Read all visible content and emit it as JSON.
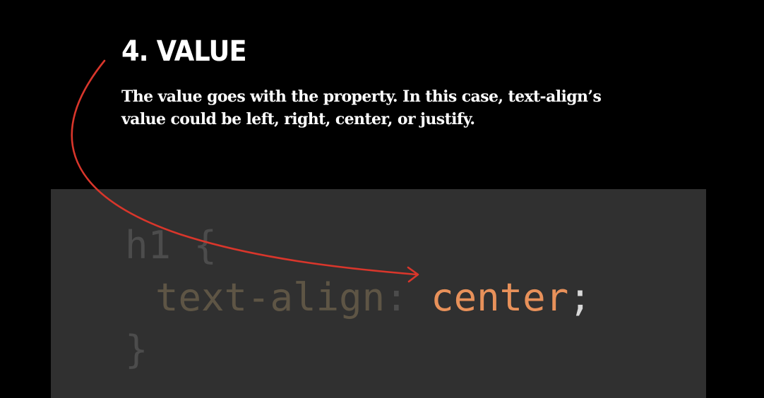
{
  "section": {
    "heading": "4. VALUE",
    "description": "The value goes with the property. In this case, text-align’s value could be left, right, center, or justify."
  },
  "code": {
    "selector": "h1",
    "brace_open": "{",
    "property": "text-align",
    "colon": ":",
    "value": "center",
    "semicolon": ";",
    "brace_close": "}"
  },
  "colors": {
    "background": "#000000",
    "code_panel": "#303030",
    "arrow": "#d9362b",
    "value_highlight": "#e8915a",
    "dimmed_code": "#4c4c4c",
    "dimmed_property": "#5e5545"
  }
}
